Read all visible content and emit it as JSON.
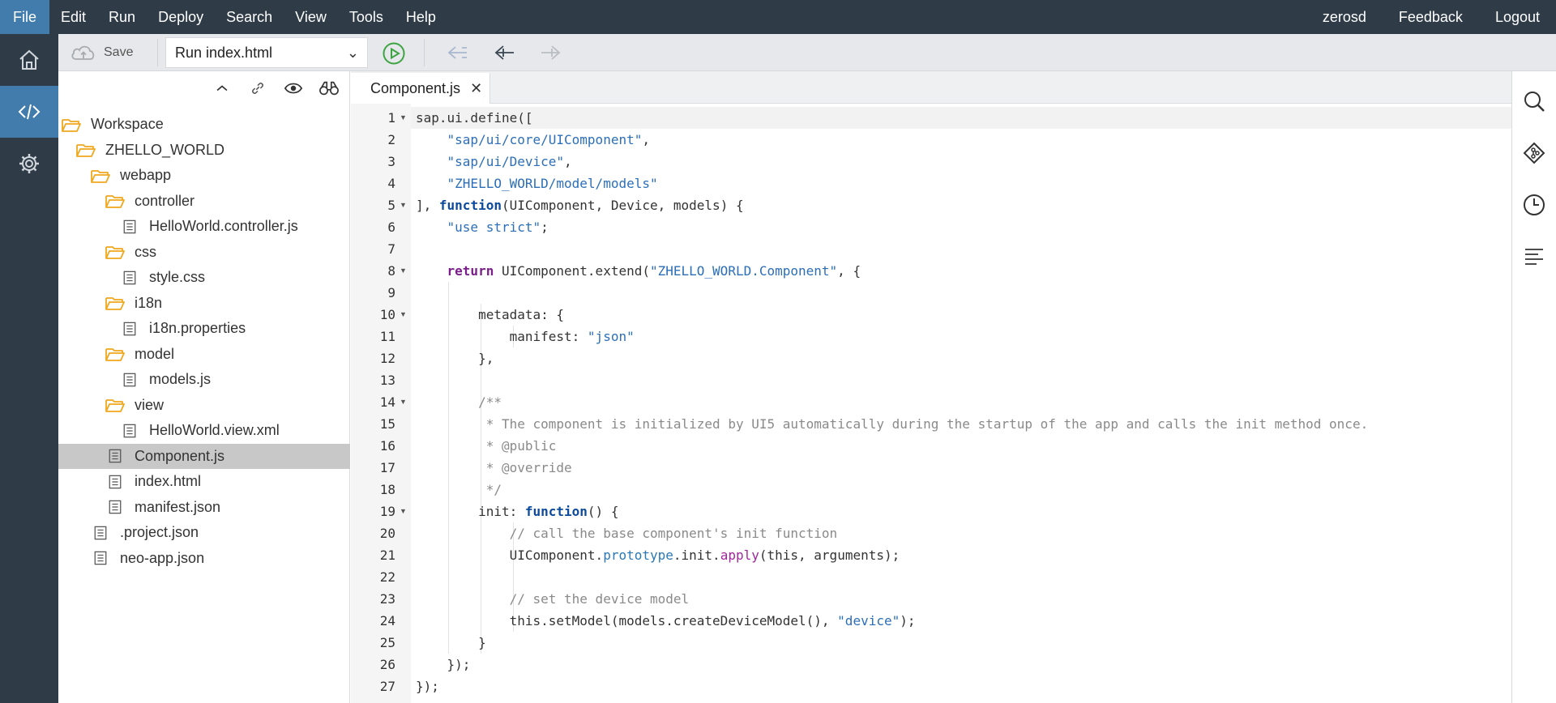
{
  "menubar": {
    "items": [
      "File",
      "Edit",
      "Run",
      "Deploy",
      "Search",
      "View",
      "Tools",
      "Help"
    ],
    "active": "File",
    "user": "zerosd",
    "feedback": "Feedback",
    "logout": "Logout"
  },
  "rail": {
    "items": [
      "home-icon",
      "code-icon",
      "gear-icon"
    ],
    "active": "code-icon"
  },
  "toolbar": {
    "save_label": "Save",
    "run_config": "Run index.html"
  },
  "explorer": {
    "tree": [
      {
        "label": "Workspace",
        "type": "folder",
        "level": 0
      },
      {
        "label": "ZHELLO_WORLD",
        "type": "folder",
        "level": 1
      },
      {
        "label": "webapp",
        "type": "folder",
        "level": 2
      },
      {
        "label": "controller",
        "type": "folder",
        "level": 3
      },
      {
        "label": "HelloWorld.controller.js",
        "type": "file",
        "level": 4
      },
      {
        "label": "css",
        "type": "folder",
        "level": 3
      },
      {
        "label": "style.css",
        "type": "file",
        "level": 4
      },
      {
        "label": "i18n",
        "type": "folder",
        "level": 3
      },
      {
        "label": "i18n.properties",
        "type": "file",
        "level": 4
      },
      {
        "label": "model",
        "type": "folder",
        "level": 3
      },
      {
        "label": "models.js",
        "type": "file",
        "level": 4
      },
      {
        "label": "view",
        "type": "folder",
        "level": 3
      },
      {
        "label": "HelloWorld.view.xml",
        "type": "file",
        "level": 4
      },
      {
        "label": "Component.js",
        "type": "file",
        "level": 3,
        "selected": true
      },
      {
        "label": "index.html",
        "type": "file",
        "level": 3
      },
      {
        "label": "manifest.json",
        "type": "file",
        "level": 3
      },
      {
        "label": ".project.json",
        "type": "file",
        "level": 2
      },
      {
        "label": "neo-app.json",
        "type": "file",
        "level": 2
      }
    ]
  },
  "editor": {
    "tab_label": "Component.js",
    "tab_close": "✕",
    "lines": [
      {
        "n": "1",
        "fold": true,
        "html": "sap.ui.define(["
      },
      {
        "n": "2",
        "fold": false,
        "html": "    <span class=\"str\">\"sap/ui/core/UIComponent\"</span>,"
      },
      {
        "n": "3",
        "fold": false,
        "html": "    <span class=\"str\">\"sap/ui/Device\"</span>,"
      },
      {
        "n": "4",
        "fold": false,
        "html": "    <span class=\"str\">\"ZHELLO_WORLD/model/models\"</span>"
      },
      {
        "n": "5",
        "fold": true,
        "html": "], <span class=\"kwb\">function</span>(UIComponent, Device, models) {"
      },
      {
        "n": "6",
        "fold": false,
        "html": "    <span class=\"str\">\"use strict\"</span>;"
      },
      {
        "n": "7",
        "fold": false,
        "html": ""
      },
      {
        "n": "8",
        "fold": true,
        "html": "    <span class=\"kw\">return</span> UIComponent.extend(<span class=\"str\">\"ZHELLO_WORLD.Component\"</span>, {"
      },
      {
        "n": "9",
        "fold": false,
        "html": ""
      },
      {
        "n": "10",
        "fold": true,
        "html": "        metadata: {"
      },
      {
        "n": "11",
        "fold": false,
        "html": "            manifest: <span class=\"str\">\"json\"</span>"
      },
      {
        "n": "12",
        "fold": false,
        "html": "        },"
      },
      {
        "n": "13",
        "fold": false,
        "html": ""
      },
      {
        "n": "14",
        "fold": true,
        "html": "        <span class=\"cmt\">/**</span>"
      },
      {
        "n": "15",
        "fold": false,
        "html": "<span class=\"cmt\">         * The component is initialized by UI5 automatically during the startup of the app and calls the init method once.</span>"
      },
      {
        "n": "16",
        "fold": false,
        "html": "<span class=\"cmt\">         * @public</span>"
      },
      {
        "n": "17",
        "fold": false,
        "html": "<span class=\"cmt\">         * @override</span>"
      },
      {
        "n": "18",
        "fold": false,
        "html": "<span class=\"cmt\">         */</span>"
      },
      {
        "n": "19",
        "fold": true,
        "html": "        init: <span class=\"kwb\">function</span>() {"
      },
      {
        "n": "20",
        "fold": false,
        "html": "            <span class=\"cmt\">// call the base component's init function</span>"
      },
      {
        "n": "21",
        "fold": false,
        "html": "            UIComponent.<span class=\"proto\">prototype</span>.init.<span class=\"meth\">apply</span>(this, arguments);"
      },
      {
        "n": "22",
        "fold": false,
        "html": ""
      },
      {
        "n": "23",
        "fold": false,
        "html": "            <span class=\"cmt\">// set the device model</span>"
      },
      {
        "n": "24",
        "fold": false,
        "html": "            this.setModel(models.createDeviceModel(), <span class=\"str\">\"device\"</span>);"
      },
      {
        "n": "25",
        "fold": false,
        "html": "        }"
      },
      {
        "n": "26",
        "fold": false,
        "html": "    });"
      },
      {
        "n": "27",
        "fold": false,
        "html": "});"
      }
    ]
  },
  "rightrail": {
    "items": [
      "search-icon",
      "git-icon",
      "history-icon",
      "outline-icon"
    ]
  },
  "colors": {
    "menubar_bg": "#2f3c48",
    "active_bg": "#427cac",
    "folder": "#f0a81e",
    "run": "#3ea443"
  }
}
